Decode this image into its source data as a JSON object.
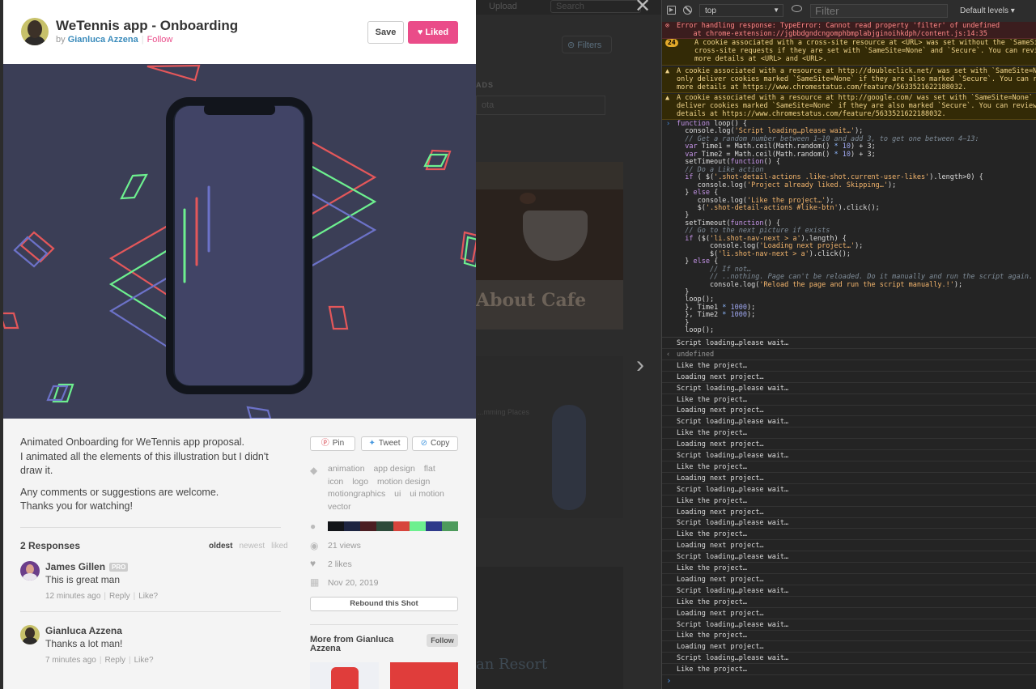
{
  "modal": {
    "title": "WeTennis app - Onboarding",
    "by": "by",
    "author": "Gianluca Azzena",
    "follow": "Follow",
    "save_label": "Save",
    "liked_label": "Liked",
    "description": [
      "Animated Onboarding for WeTennis app proposal.\nI animated all the elements of this illustration but I didn't draw it.",
      "Any comments or suggestions are welcome.\nThanks you for watching!"
    ],
    "responses_heading": "2 Responses",
    "sort": [
      "oldest",
      "newest",
      "liked"
    ],
    "comments": [
      {
        "name": "James Gillen",
        "badge": "PRO",
        "text": "This is great man",
        "time": "12 minutes ago",
        "reply": "Reply",
        "like": "Like?"
      },
      {
        "name": "Gianluca Azzena",
        "badge": "",
        "text": "Thanks a lot man!",
        "time": "7 minutes ago",
        "reply": "Reply",
        "like": "Like?"
      }
    ],
    "share": {
      "pin": "Pin",
      "tweet": "Tweet",
      "copy": "Copy"
    },
    "tags": [
      "animation",
      "app design",
      "flat",
      "icon",
      "logo",
      "motion design",
      "motiongraphics",
      "ui",
      "ui motion",
      "vector"
    ],
    "palette": [
      "#121418",
      "#1d2440",
      "#4b1e22",
      "#2d4a3a",
      "#d7443c",
      "#6df08f",
      "#2e3a8a",
      "#4d9a5c"
    ],
    "views": "21 views",
    "likes": "2 likes",
    "date": "Nov 20, 2019",
    "rebound": "Rebound this Shot",
    "more_from": "More from Gianluca Azzena",
    "more_follow": "Follow",
    "colors": {
      "pink": "#ea4c89",
      "link": "#3a8bbb",
      "illustration_bg": "#3b3e56"
    }
  },
  "background": {
    "upload": "Upload",
    "search": "Search",
    "filters": "Filters",
    "ads": "ADS",
    "field": "ota",
    "shot_title": "About Cafe",
    "card_text": "...mming Places",
    "resort": "an Resort"
  },
  "devtools": {
    "context": "top",
    "filter_placeholder": "Filter",
    "levels": "Default levels ▾",
    "messages": [
      {
        "type": "err",
        "text": "Error handling response: TypeError: Cannot read property 'filter' of undefined\n    at chrome-extension://jgbbdgndcngomphbmplabjginoihkdph/content.js:14:35"
      },
      {
        "type": "warn",
        "count": "24",
        "text": "A cookie associated with a cross-site resource at <URL> was set without the `SameSite`\ncross-site requests if they are set with `SameSite=None` and `Secure`. You can review c\nmore details at <URL> and <URL>."
      },
      {
        "type": "warn",
        "text": "A cookie associated with a resource at http://doubleclick.net/ was set with `SameSite=None`\nonly deliver cookies marked `SameSite=None` if they are also marked `Secure`. You can review\nmore details at https://www.chromestatus.com/feature/5633521622188032."
      },
      {
        "type": "warn",
        "text": "A cookie associated with a resource at http://google.com/ was set with `SameSite=None` but w\ndeliver cookies marked `SameSite=None` if they are also marked `Secure`. You can review cook\ndetails at https://www.chromestatus.com/feature/5633521622188032."
      }
    ],
    "code": "function loop() {\n  console.log('Script loading…please wait…');\n  // Get a random number between 1–10 and add 3, to get one between 4–13:\n  var Time1 = Math.ceil(Math.random() * 10) + 3;\n  var Time2 = Math.ceil(Math.random() * 10) + 3;\n  setTimeout(function() {\n  // Do a Like action\n  if ( $('.shot-detail-actions .like-shot.current-user-likes').length>0) {\n     console.log('Project already liked. Skipping…');\n  } else {\n     console.log('Like the project…');\n     $('.shot-detail-actions #like-btn').click();\n  }\n  setTimeout(function() {\n  // Go to the next picture if exists\n  if ($('li.shot-nav-next > a').length) {\n        console.log('Loading next project…');\n        $('li.shot-nav-next > a').click();\n  } else {\n        // If not…\n        // ..nothing. Page can't be reloaded. Do it manually and run the script again.\n        console.log('Reload the page and run the script manually.!');\n  }\n  loop();\n  }, Time1 * 1000);\n  }, Time2 * 1000);\n  }\n  loop();",
    "logs": [
      "Script loading…please wait…",
      "undefined",
      "Like the project…",
      "Loading next project…",
      "Script loading…please wait…",
      "Like the project…",
      "Loading next project…",
      "Script loading…please wait…",
      "Like the project…",
      "Loading next project…",
      "Script loading…please wait…",
      "Like the project…",
      "Loading next project…",
      "Script loading…please wait…",
      "Like the project…",
      "Loading next project…",
      "Script loading…please wait…",
      "Like the project…",
      "Loading next project…",
      "Script loading…please wait…",
      "Like the project…",
      "Loading next project…",
      "Script loading…please wait…",
      "Like the project…",
      "Loading next project…",
      "Script loading…please wait…",
      "Like the project…",
      "Loading next project…",
      "Script loading…please wait…",
      "Like the project…"
    ]
  }
}
